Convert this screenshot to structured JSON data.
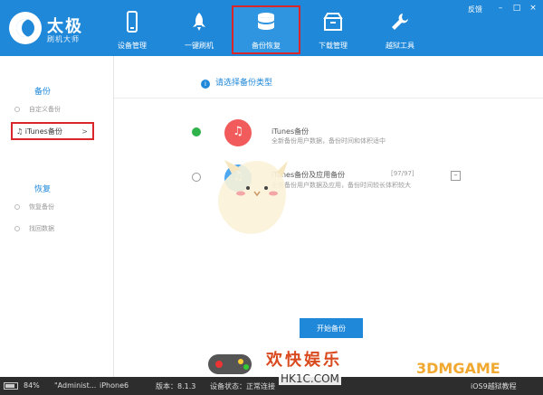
{
  "header": {
    "logo_title": "太极",
    "logo_subtitle": "刷机大师",
    "nav": [
      {
        "label": "设备管理",
        "icon": "phone-icon"
      },
      {
        "label": "一键刷机",
        "icon": "rocket-icon"
      },
      {
        "label": "备份恢复",
        "icon": "database-icon",
        "active": true
      },
      {
        "label": "下载管理",
        "icon": "download-box-icon"
      },
      {
        "label": "越狱工具",
        "icon": "wrench-icon"
      }
    ],
    "feedback": "反馈"
  },
  "sidebar": {
    "backup_section": "备份",
    "backup_items": [
      {
        "label": "自定义备份"
      },
      {
        "label": "iTunes备份",
        "selected": true,
        "arrow": ">"
      }
    ],
    "restore_section": "恢复",
    "restore_items": [
      {
        "label": "恢复备份"
      },
      {
        "label": "找回数据"
      }
    ]
  },
  "main": {
    "info": "请选择备份类型",
    "options": [
      {
        "title": "iTunes备份",
        "desc": "全新备份用户数据，备份时间和体积适中",
        "checked": true
      },
      {
        "title": "iTunes备份及应用备份",
        "count": "[97/97]",
        "desc": "全新备份用户数据及应用，备份时间较长体积较大",
        "checked": false
      }
    ],
    "expand": "–",
    "start_button": "开始备份"
  },
  "status_bar": {
    "battery": "84%",
    "user": "\"Administ...",
    "device": "iPhone6",
    "version": "版本：8.1.3",
    "device_status": "设备状态：正常连接",
    "right": "iOS9越狱教程"
  },
  "watermark": {
    "title": "欢快娱乐",
    "site": "HK1C.COM",
    "brand": "3DMGAME"
  },
  "colors": {
    "header_blue": "#1f88d9",
    "highlight_red": "#d9262b",
    "itunes_red": "#f25b5b",
    "itunes_blue": "#4da8f0",
    "radio_green": "#2fb34a"
  }
}
